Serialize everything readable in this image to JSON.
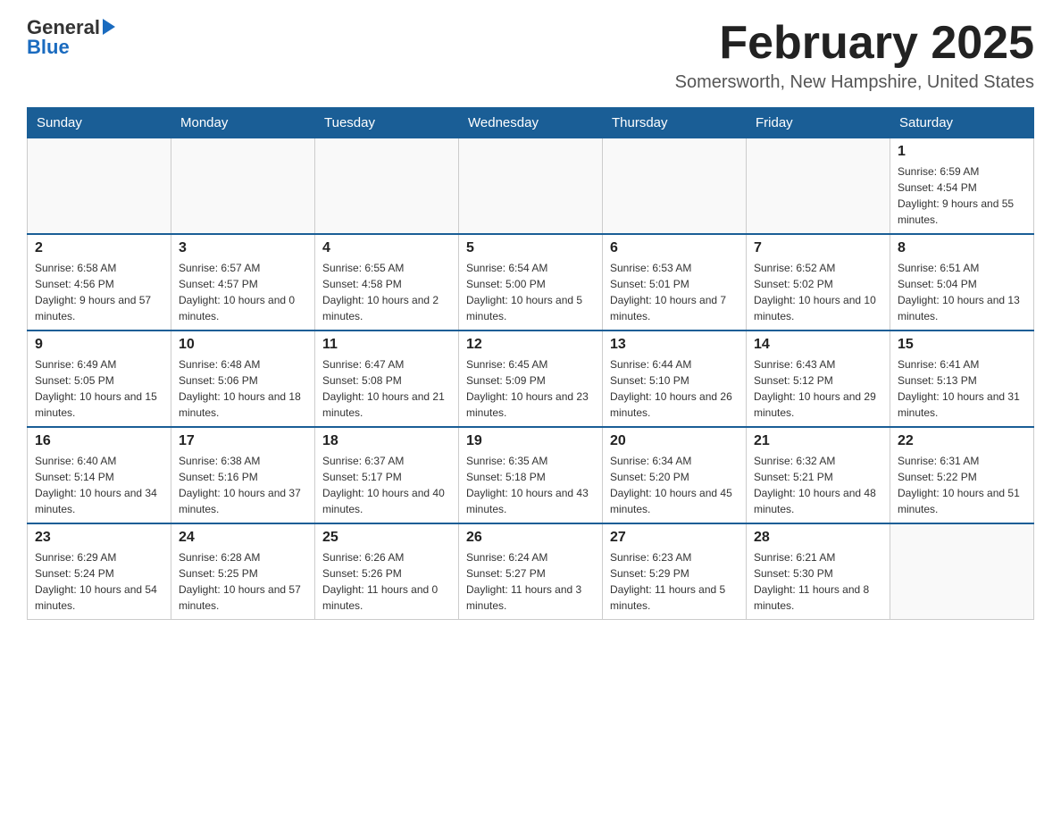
{
  "header": {
    "logo_general": "General",
    "logo_blue": "Blue",
    "page_title": "February 2025",
    "subtitle": "Somersworth, New Hampshire, United States"
  },
  "days_of_week": [
    "Sunday",
    "Monday",
    "Tuesday",
    "Wednesday",
    "Thursday",
    "Friday",
    "Saturday"
  ],
  "weeks": [
    [
      {
        "day": "",
        "info": ""
      },
      {
        "day": "",
        "info": ""
      },
      {
        "day": "",
        "info": ""
      },
      {
        "day": "",
        "info": ""
      },
      {
        "day": "",
        "info": ""
      },
      {
        "day": "",
        "info": ""
      },
      {
        "day": "1",
        "info": "Sunrise: 6:59 AM\nSunset: 4:54 PM\nDaylight: 9 hours and 55 minutes."
      }
    ],
    [
      {
        "day": "2",
        "info": "Sunrise: 6:58 AM\nSunset: 4:56 PM\nDaylight: 9 hours and 57 minutes."
      },
      {
        "day": "3",
        "info": "Sunrise: 6:57 AM\nSunset: 4:57 PM\nDaylight: 10 hours and 0 minutes."
      },
      {
        "day": "4",
        "info": "Sunrise: 6:55 AM\nSunset: 4:58 PM\nDaylight: 10 hours and 2 minutes."
      },
      {
        "day": "5",
        "info": "Sunrise: 6:54 AM\nSunset: 5:00 PM\nDaylight: 10 hours and 5 minutes."
      },
      {
        "day": "6",
        "info": "Sunrise: 6:53 AM\nSunset: 5:01 PM\nDaylight: 10 hours and 7 minutes."
      },
      {
        "day": "7",
        "info": "Sunrise: 6:52 AM\nSunset: 5:02 PM\nDaylight: 10 hours and 10 minutes."
      },
      {
        "day": "8",
        "info": "Sunrise: 6:51 AM\nSunset: 5:04 PM\nDaylight: 10 hours and 13 minutes."
      }
    ],
    [
      {
        "day": "9",
        "info": "Sunrise: 6:49 AM\nSunset: 5:05 PM\nDaylight: 10 hours and 15 minutes."
      },
      {
        "day": "10",
        "info": "Sunrise: 6:48 AM\nSunset: 5:06 PM\nDaylight: 10 hours and 18 minutes."
      },
      {
        "day": "11",
        "info": "Sunrise: 6:47 AM\nSunset: 5:08 PM\nDaylight: 10 hours and 21 minutes."
      },
      {
        "day": "12",
        "info": "Sunrise: 6:45 AM\nSunset: 5:09 PM\nDaylight: 10 hours and 23 minutes."
      },
      {
        "day": "13",
        "info": "Sunrise: 6:44 AM\nSunset: 5:10 PM\nDaylight: 10 hours and 26 minutes."
      },
      {
        "day": "14",
        "info": "Sunrise: 6:43 AM\nSunset: 5:12 PM\nDaylight: 10 hours and 29 minutes."
      },
      {
        "day": "15",
        "info": "Sunrise: 6:41 AM\nSunset: 5:13 PM\nDaylight: 10 hours and 31 minutes."
      }
    ],
    [
      {
        "day": "16",
        "info": "Sunrise: 6:40 AM\nSunset: 5:14 PM\nDaylight: 10 hours and 34 minutes."
      },
      {
        "day": "17",
        "info": "Sunrise: 6:38 AM\nSunset: 5:16 PM\nDaylight: 10 hours and 37 minutes."
      },
      {
        "day": "18",
        "info": "Sunrise: 6:37 AM\nSunset: 5:17 PM\nDaylight: 10 hours and 40 minutes."
      },
      {
        "day": "19",
        "info": "Sunrise: 6:35 AM\nSunset: 5:18 PM\nDaylight: 10 hours and 43 minutes."
      },
      {
        "day": "20",
        "info": "Sunrise: 6:34 AM\nSunset: 5:20 PM\nDaylight: 10 hours and 45 minutes."
      },
      {
        "day": "21",
        "info": "Sunrise: 6:32 AM\nSunset: 5:21 PM\nDaylight: 10 hours and 48 minutes."
      },
      {
        "day": "22",
        "info": "Sunrise: 6:31 AM\nSunset: 5:22 PM\nDaylight: 10 hours and 51 minutes."
      }
    ],
    [
      {
        "day": "23",
        "info": "Sunrise: 6:29 AM\nSunset: 5:24 PM\nDaylight: 10 hours and 54 minutes."
      },
      {
        "day": "24",
        "info": "Sunrise: 6:28 AM\nSunset: 5:25 PM\nDaylight: 10 hours and 57 minutes."
      },
      {
        "day": "25",
        "info": "Sunrise: 6:26 AM\nSunset: 5:26 PM\nDaylight: 11 hours and 0 minutes."
      },
      {
        "day": "26",
        "info": "Sunrise: 6:24 AM\nSunset: 5:27 PM\nDaylight: 11 hours and 3 minutes."
      },
      {
        "day": "27",
        "info": "Sunrise: 6:23 AM\nSunset: 5:29 PM\nDaylight: 11 hours and 5 minutes."
      },
      {
        "day": "28",
        "info": "Sunrise: 6:21 AM\nSunset: 5:30 PM\nDaylight: 11 hours and 8 minutes."
      },
      {
        "day": "",
        "info": ""
      }
    ]
  ]
}
